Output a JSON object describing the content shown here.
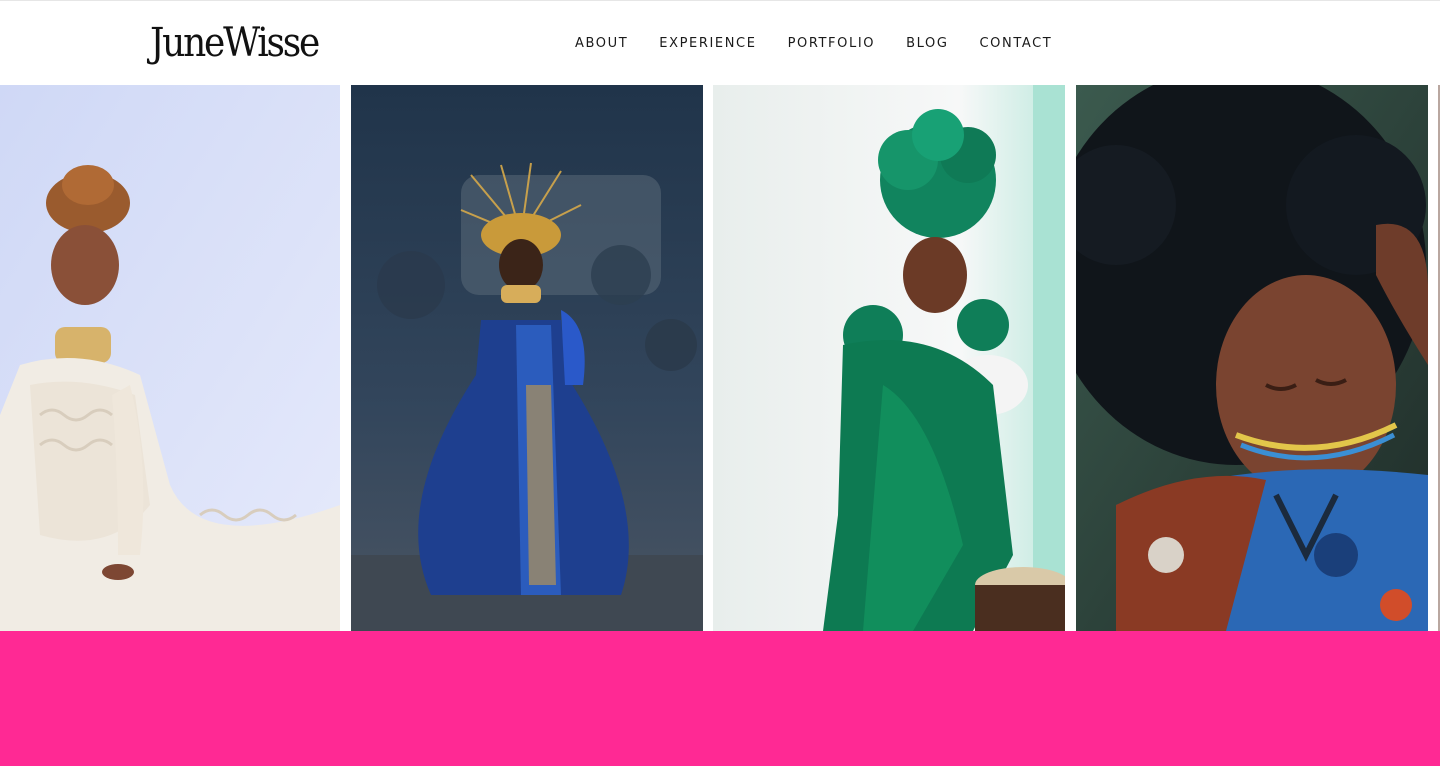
{
  "header": {
    "logo_text": "JuneWisse",
    "nav": [
      {
        "label": "ABOUT"
      },
      {
        "label": "EXPERIENCE"
      },
      {
        "label": "PORTFOLIO"
      },
      {
        "label": "BLOG"
      },
      {
        "label": "CONTACT"
      }
    ]
  },
  "gallery": {
    "photos": [
      {
        "name": "girl-in-white-lace-dress"
      },
      {
        "name": "girl-in-blue-gown-with-gold-crown"
      },
      {
        "name": "girl-in-green-satin-with-green-headpiece"
      },
      {
        "name": "girl-with-afro-eyes-closed"
      }
    ]
  },
  "colors": {
    "band": "#ff2994",
    "text": "#1a1a1a",
    "background": "#ffffff"
  }
}
